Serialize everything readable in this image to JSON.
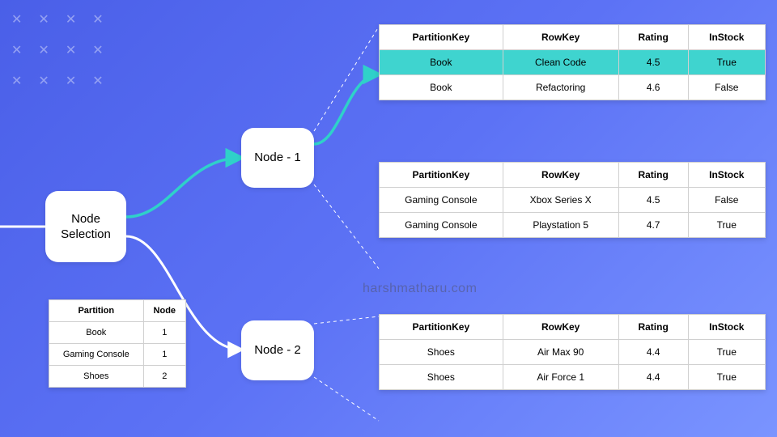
{
  "decor": {
    "x": "✕"
  },
  "nodes": {
    "selection": "Node\nSelection",
    "n1": "Node - 1",
    "n2": "Node - 2"
  },
  "partition_table": {
    "headers": [
      "Partition",
      "Node"
    ],
    "rows": [
      [
        "Book",
        "1"
      ],
      [
        "Gaming Console",
        "1"
      ],
      [
        "Shoes",
        "2"
      ]
    ]
  },
  "data_tables": {
    "headers": [
      "PartitionKey",
      "RowKey",
      "Rating",
      "InStock"
    ],
    "top": {
      "rows": [
        {
          "cells": [
            "Book",
            "Clean Code",
            "4.5",
            "True"
          ],
          "highlight": true
        },
        {
          "cells": [
            "Book",
            "Refactoring",
            "4.6",
            "False"
          ],
          "highlight": false
        }
      ]
    },
    "mid": {
      "rows": [
        {
          "cells": [
            "Gaming Console",
            "Xbox Series X",
            "4.5",
            "False"
          ],
          "highlight": false
        },
        {
          "cells": [
            "Gaming Console",
            "Playstation 5",
            "4.7",
            "True"
          ],
          "highlight": false
        }
      ]
    },
    "bot": {
      "rows": [
        {
          "cells": [
            "Shoes",
            "Air Max 90",
            "4.4",
            "True"
          ],
          "highlight": false
        },
        {
          "cells": [
            "Shoes",
            "Air Force 1",
            "4.4",
            "True"
          ],
          "highlight": false
        }
      ]
    }
  },
  "watermark": "harshmatharu.com",
  "chart_data": {
    "type": "table",
    "title": "Node Selection – partition-to-node mapping with stored rows",
    "partition_map": [
      {
        "partition": "Book",
        "node": 1
      },
      {
        "partition": "Gaming Console",
        "node": 1
      },
      {
        "partition": "Shoes",
        "node": 2
      }
    ],
    "nodes": [
      {
        "name": "Node - 1",
        "partitions": [
          {
            "partition": "Book",
            "rows": [
              {
                "PartitionKey": "Book",
                "RowKey": "Clean Code",
                "Rating": 4.5,
                "InStock": true
              },
              {
                "PartitionKey": "Book",
                "RowKey": "Refactoring",
                "Rating": 4.6,
                "InStock": false
              }
            ]
          },
          {
            "partition": "Gaming Console",
            "rows": [
              {
                "PartitionKey": "Gaming Console",
                "RowKey": "Xbox Series X",
                "Rating": 4.5,
                "InStock": false
              },
              {
                "PartitionKey": "Gaming Console",
                "RowKey": "Playstation 5",
                "Rating": 4.7,
                "InStock": true
              }
            ]
          }
        ]
      },
      {
        "name": "Node - 2",
        "partitions": [
          {
            "partition": "Shoes",
            "rows": [
              {
                "PartitionKey": "Shoes",
                "RowKey": "Air Max 90",
                "Rating": 4.4,
                "InStock": true
              },
              {
                "PartitionKey": "Shoes",
                "RowKey": "Air Force 1",
                "Rating": 4.4,
                "InStock": true
              }
            ]
          }
        ]
      }
    ]
  }
}
